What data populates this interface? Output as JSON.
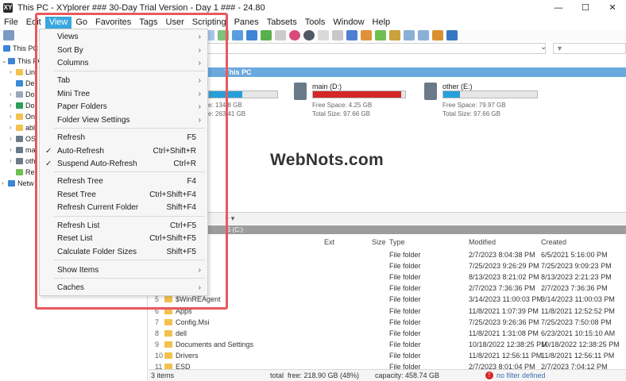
{
  "window": {
    "app_icon": "XY",
    "title": "This PC - XYplorer ### 30-Day Trial Version - Day 1 ### - 24.80",
    "minimize": "—",
    "maximize": "☐",
    "close": "✕"
  },
  "menubar": {
    "items": [
      "File",
      "Edit",
      "View",
      "Go",
      "Favorites",
      "Tags",
      "User",
      "Scripting",
      "Panes",
      "Tabsets",
      "Tools",
      "Window",
      "Help"
    ]
  },
  "tree": {
    "items": [
      {
        "label": "This PC",
        "arrow": ""
      },
      {
        "label": "This PC",
        "arrow": "⌄"
      },
      {
        "label": "Lin",
        "arrow": "›"
      },
      {
        "label": "De",
        "arrow": ""
      },
      {
        "label": "Do",
        "arrow": "›"
      },
      {
        "label": "Do",
        "arrow": "›"
      },
      {
        "label": "On",
        "arrow": "›"
      },
      {
        "label": "abl",
        "arrow": "›"
      },
      {
        "label": "OS",
        "arrow": "›"
      },
      {
        "label": "ma",
        "arrow": "›"
      },
      {
        "label": "oth",
        "arrow": "›"
      },
      {
        "label": "Re",
        "arrow": ""
      },
      {
        "label": "Netw",
        "arrow": "›"
      }
    ]
  },
  "filter": {
    "icon": "▼"
  },
  "address": {
    "chevron": "⌄"
  },
  "pane1": {
    "title": "This PC"
  },
  "drives": [
    {
      "name": "",
      "free": "Free Space: 134.8 GB",
      "free_visible": "e: 134.8 GB",
      "total_visible": "e: 263.41 GB",
      "used_fraction": 0.49,
      "color": "#26a0da"
    },
    {
      "name": "main (D:)",
      "free": "Free Space: 4.25 GB",
      "total": "Total Size: 97.66 GB",
      "used_fraction": 0.957,
      "color": "#d42727"
    },
    {
      "name": "other (E:)",
      "free": "Free Space: 79.97 GB",
      "total": "Total Size: 97.66 GB",
      "used_fraction": 0.181,
      "color": "#26a0da"
    }
  ],
  "watermark": "WebNots.com",
  "pane2": {
    "title": "S (C:)",
    "tab_plus": "+ ▾"
  },
  "list": {
    "headers": {
      "ext": "Ext",
      "size": "Size",
      "type": "Type",
      "modified": "Modified",
      "created": "Created"
    },
    "rows": [
      {
        "num": "",
        "name": "n",
        "type": "File folder",
        "modified": "2/7/2023 8:04:38 PM",
        "created": "6/5/2021 5:16:00 PM"
      },
      {
        "num": "",
        "name": "",
        "type": "File folder",
        "modified": "7/25/2023 9:26:29 PM",
        "created": "7/25/2023 9:09:23 PM"
      },
      {
        "num": "",
        "name": ".~BT",
        "type": "File folder",
        "modified": "8/13/2023 8:21:02 PM",
        "created": "8/13/2023 2:21:23 PM"
      },
      {
        "num": "",
        "name": "~WS",
        "type": "File folder",
        "modified": "2/7/2023 7:36:36 PM",
        "created": "2/7/2023 7:36:36 PM"
      },
      {
        "num": "5",
        "name": "$WinREAgent",
        "type": "File folder",
        "modified": "3/14/2023 11:00:03 PM",
        "created": "3/14/2023 11:00:03 PM"
      },
      {
        "num": "6",
        "name": "Apps",
        "type": "File folder",
        "modified": "11/8/2021 1:07:39 PM",
        "created": "11/8/2021 12:52:52 PM"
      },
      {
        "num": "7",
        "name": "Config.Msi",
        "type": "File folder",
        "modified": "7/25/2023 9:26:36 PM",
        "created": "7/25/2023 7:50:08 PM"
      },
      {
        "num": "8",
        "name": "dell",
        "type": "File folder",
        "modified": "11/8/2021 1:31:08 PM",
        "created": "6/23/2021 10:15:10 AM"
      },
      {
        "num": "9",
        "name": "Documents and Settings",
        "type": "File folder",
        "modified": "10/18/2022 12:38:25 PM",
        "created": "10/18/2022 12:38:25 PM"
      },
      {
        "num": "10",
        "name": "Drivers",
        "type": "File folder",
        "modified": "11/8/2021 12:56:11 PM",
        "created": "11/8/2021 12:56:11 PM"
      },
      {
        "num": "11",
        "name": "ESD",
        "type": "File folder",
        "modified": "2/7/2023 8:01:04 PM",
        "created": "2/7/2023 7:04:12 PM"
      }
    ]
  },
  "status": {
    "items": "3 items",
    "total": "total",
    "free": "free: 218.90 GB (48%)",
    "capacity": "capacity: 458.74 GB",
    "warn": "!",
    "filter": "no filter defined"
  },
  "view_menu": {
    "items": [
      {
        "label": "Views",
        "shortcut": "",
        "check": "",
        "arrow": "›"
      },
      {
        "label": "Sort By",
        "shortcut": "",
        "check": "",
        "arrow": "›"
      },
      {
        "label": "Columns",
        "shortcut": "",
        "check": "",
        "arrow": "›"
      },
      {
        "label": "Tab",
        "shortcut": "",
        "check": "",
        "arrow": "›"
      },
      {
        "label": "Mini Tree",
        "shortcut": "",
        "check": "",
        "arrow": "›"
      },
      {
        "label": "Paper Folders",
        "shortcut": "",
        "check": "",
        "arrow": "›"
      },
      {
        "label": "Folder View Settings",
        "shortcut": "",
        "check": "",
        "arrow": "›"
      },
      {
        "label": "Refresh",
        "shortcut": "F5",
        "check": "",
        "arrow": ""
      },
      {
        "label": "Auto-Refresh",
        "shortcut": "Ctrl+Shift+R",
        "check": "✓",
        "arrow": ""
      },
      {
        "label": "Suspend Auto-Refresh",
        "shortcut": "Ctrl+R",
        "check": "✓",
        "arrow": ""
      },
      {
        "label": "Refresh Tree",
        "shortcut": "F4",
        "check": "",
        "arrow": ""
      },
      {
        "label": "Reset Tree",
        "shortcut": "Ctrl+Shift+F4",
        "check": "",
        "arrow": ""
      },
      {
        "label": "Refresh Current Folder",
        "shortcut": "Shift+F4",
        "check": "",
        "arrow": ""
      },
      {
        "label": "Refresh List",
        "shortcut": "Ctrl+F5",
        "check": "",
        "arrow": ""
      },
      {
        "label": "Reset List",
        "shortcut": "Ctrl+Shift+F5",
        "check": "",
        "arrow": ""
      },
      {
        "label": "Calculate Folder Sizes",
        "shortcut": "Shift+F5",
        "check": "",
        "arrow": ""
      },
      {
        "label": "Show Items",
        "shortcut": "",
        "check": "",
        "arrow": "›"
      },
      {
        "label": "Caches",
        "shortcut": "",
        "check": "",
        "arrow": "›"
      }
    ]
  },
  "colors": {
    "menu_active": "#39a7df",
    "highlight_border": "#e8595e",
    "pane_title": "#6aa9dd",
    "drive_warn": "#d42727",
    "drive_ok": "#26a0da"
  }
}
